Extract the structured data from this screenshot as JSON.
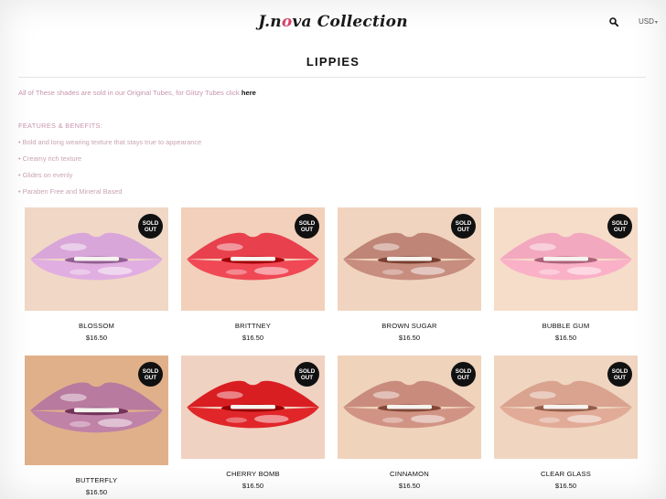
{
  "header": {
    "logo_prefix": "J.n",
    "logo_suffix": "va Collection",
    "currency": "USD"
  },
  "page_title": "LIPPIES",
  "intro": {
    "text": "All of These shades are sold in our Original Tubes, for Glitzy Tubes click ",
    "link": "here"
  },
  "features": {
    "title": "FEATURES & BENEFITS:",
    "items": [
      "Bold and long wearing texture that stays true to appearance",
      "Creamy rich texture",
      "Glides on evenly",
      "Paraben Free and Mineral Based"
    ]
  },
  "badge": {
    "line1": "SOLD",
    "line2": "OUT"
  },
  "products": [
    {
      "name": "BLOSSOM",
      "price": "$16.50",
      "lip": "#d9a6d9",
      "skin": "#f0d7c6"
    },
    {
      "name": "BRITTNEY",
      "price": "$16.50",
      "lip": "#e8404d",
      "skin": "#f2d0bb"
    },
    {
      "name": "BROWN SUGAR",
      "price": "$16.50",
      "lip": "#bf8576",
      "skin": "#f0d4bf"
    },
    {
      "name": "BUBBLE GUM",
      "price": "$16.50",
      "lip": "#f2a9bf",
      "skin": "#f6ddc9"
    },
    {
      "name": "BUTTERFLY",
      "price": "$16.50",
      "lip": "#b87a9f",
      "skin": "#e0b08a"
    },
    {
      "name": "CHERRY BOMB",
      "price": "$16.50",
      "lip": "#d91e22",
      "skin": "#f0d2c2"
    },
    {
      "name": "CINNAMON",
      "price": "$16.50",
      "lip": "#c98c7c",
      "skin": "#f0d3bb"
    },
    {
      "name": "CLEAR GLASS",
      "price": "$16.50",
      "lip": "#d9a38f",
      "skin": "#f0d5c0"
    }
  ]
}
